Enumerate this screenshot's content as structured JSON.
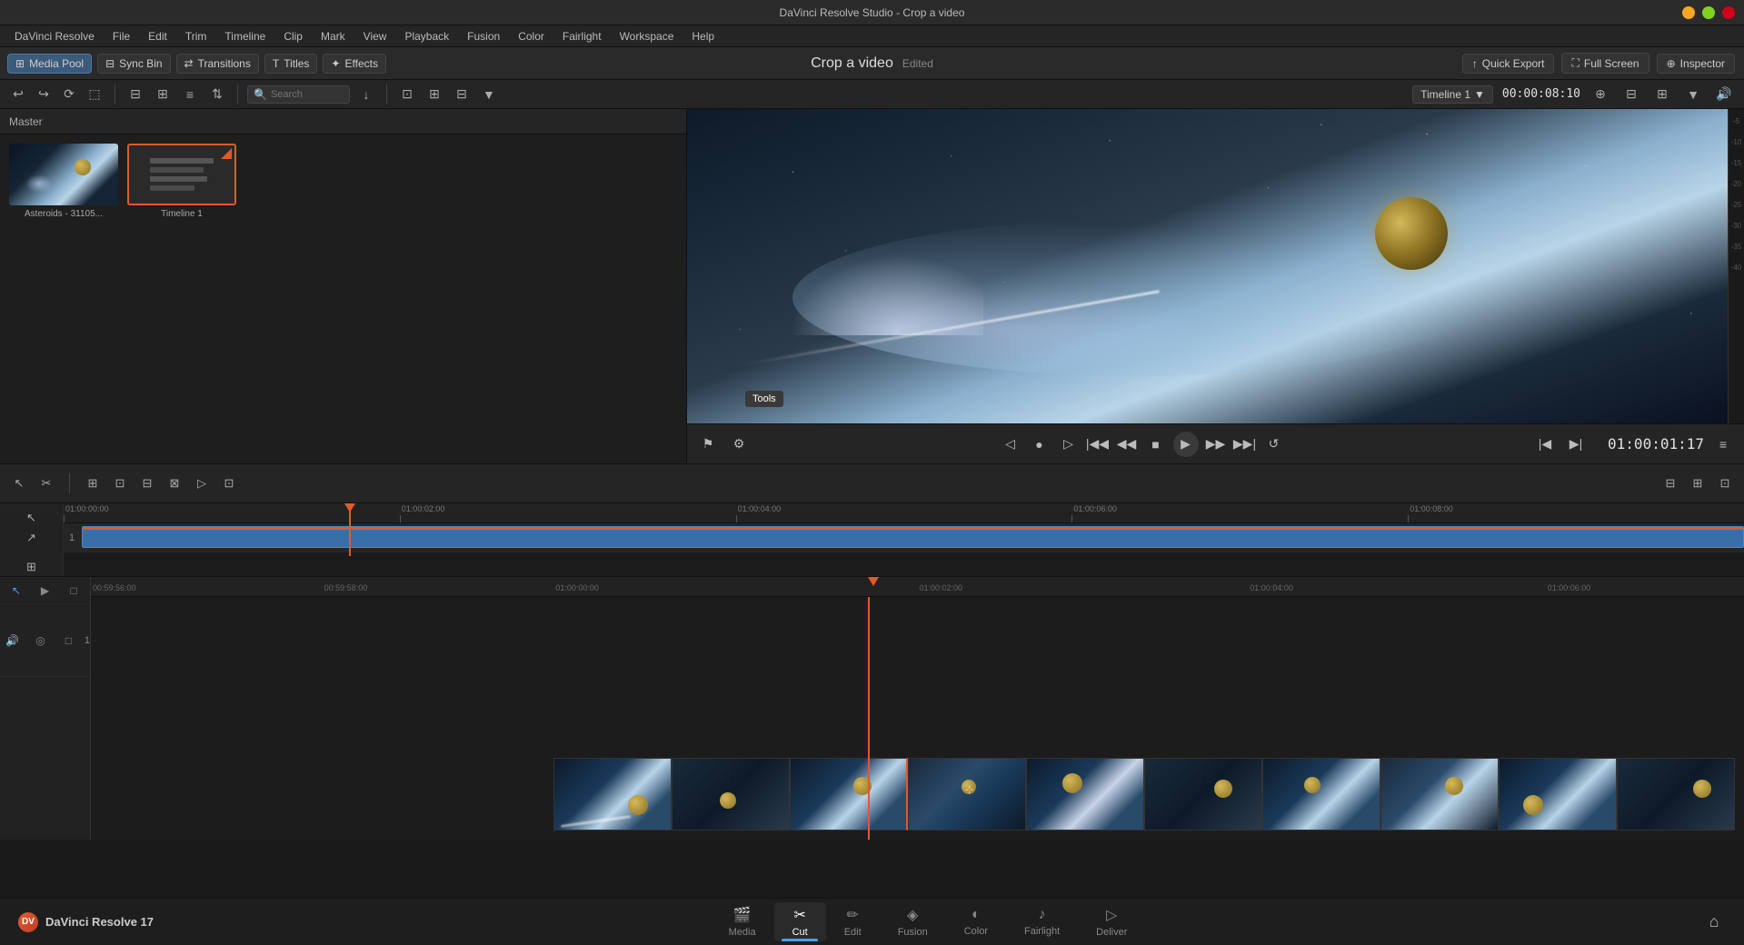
{
  "titlebar": {
    "title": "DaVinci Resolve Studio - Crop a video"
  },
  "menubar": {
    "items": [
      "DaVinci Resolve",
      "File",
      "Edit",
      "Trim",
      "Timeline",
      "Clip",
      "Mark",
      "View",
      "Playback",
      "Fusion",
      "Color",
      "Fairlight",
      "Workspace",
      "Help"
    ]
  },
  "toolbar": {
    "media_pool_label": "Media Pool",
    "sync_bin_label": "Sync Bin",
    "transitions_label": "Transitions",
    "titles_label": "Titles",
    "effects_label": "Effects"
  },
  "project": {
    "name": "Crop a video",
    "status": "Edited"
  },
  "right_toolbar": {
    "quick_export": "Quick Export",
    "full_screen": "Full Screen",
    "inspector": "Inspector"
  },
  "timeline_selector": {
    "label": "Timeline 1",
    "time": "00:00:08:10"
  },
  "media_pool": {
    "header": "Master",
    "items": [
      {
        "label": "Asteroids - 31105...",
        "type": "video"
      },
      {
        "label": "Timeline 1",
        "type": "timeline"
      }
    ]
  },
  "playback": {
    "current_time": "01:00:01:17",
    "controls": [
      "step_back_start",
      "step_back",
      "stop",
      "play",
      "step_forward",
      "step_back_end",
      "loop"
    ]
  },
  "timeline": {
    "name": "Timeline 1",
    "markers": [
      "01:00:00:00",
      "01:00:02:00",
      "01:00:04:00",
      "01:00:06:00",
      "01:00:08:00"
    ],
    "bt_markers": [
      "00:59:56:00",
      "00:59:58:00",
      "01:00:00:00",
      "01:00:02:00",
      "01:00:04:00",
      "01:00:06:00"
    ]
  },
  "tools_tooltip": "Tools",
  "nav": {
    "items": [
      {
        "label": "Media",
        "icon": "🎬",
        "active": false
      },
      {
        "label": "Cut",
        "icon": "✂",
        "active": true
      },
      {
        "label": "Edit",
        "icon": "✏",
        "active": false
      },
      {
        "label": "Fusion",
        "icon": "◈",
        "active": false
      },
      {
        "label": "Color",
        "icon": "◐",
        "active": false
      },
      {
        "label": "Fairlight",
        "icon": "♪",
        "active": false
      },
      {
        "label": "Deliver",
        "icon": "▷",
        "active": false
      }
    ]
  },
  "davinci": {
    "app_name": "DaVinci Resolve 17"
  }
}
